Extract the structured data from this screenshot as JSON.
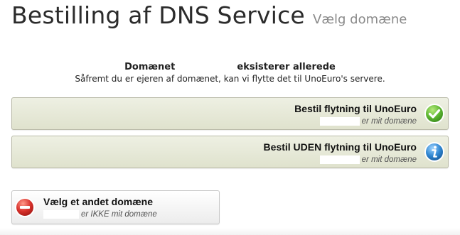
{
  "header": {
    "title": "Bestilling af DNS Service",
    "subtitle": "Vælg domæne"
  },
  "info": {
    "line1_prefix": "Domænet",
    "line1_suffix": "eksisterer allerede",
    "line2": "Såfremt du er ejeren af domænet, kan vi flytte det til UnoEuro's servere."
  },
  "options": {
    "move": {
      "title": "Bestil flytning til UnoEuro",
      "subtext": "er mit domæne",
      "icon": "check-icon",
      "icon_color": "#5cb531"
    },
    "no_move": {
      "title": "Bestil UDEN flytning til UnoEuro",
      "subtext": "er mit domæne",
      "icon": "info-icon",
      "icon_color": "#2f86d1"
    },
    "other": {
      "title": "Vælg et andet domæne",
      "subtext": "er IKKE mit domæne",
      "icon": "minus-icon",
      "icon_color": "#d7302a"
    }
  }
}
